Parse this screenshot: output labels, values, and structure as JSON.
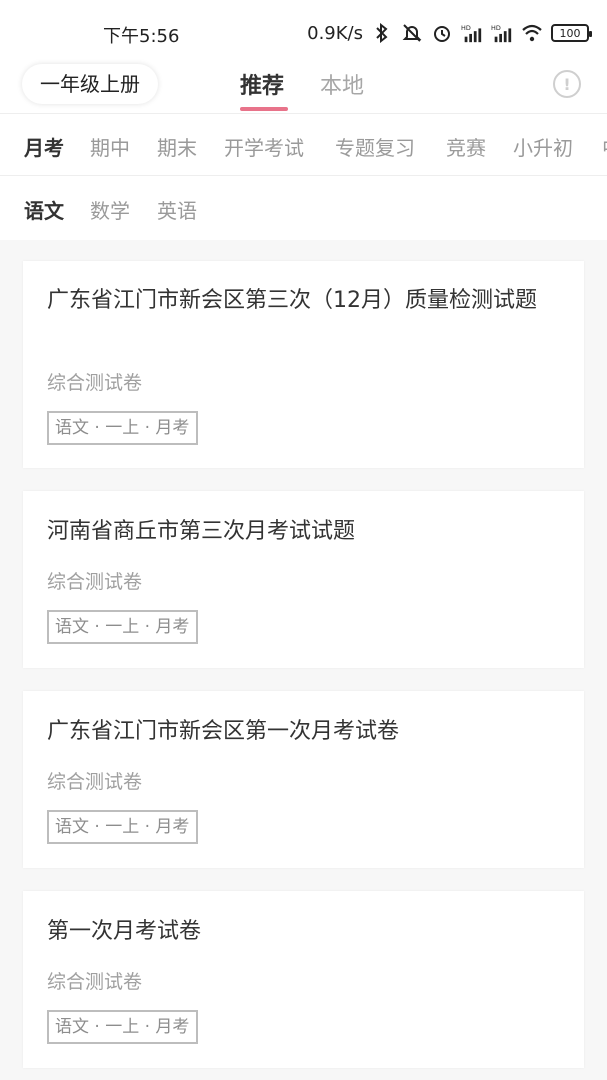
{
  "status_bar": {
    "time": "下午5:56",
    "network_speed": "0.9K/s",
    "icons": [
      "bluetooth-icon",
      "mute-bell-icon",
      "alarm-icon",
      "hd-signal-icon",
      "hd-signal-icon",
      "wifi-icon"
    ],
    "battery": "100"
  },
  "header": {
    "grade_selector": "一年级上册",
    "tabs": [
      {
        "label": "推荐",
        "active": true
      },
      {
        "label": "本地",
        "active": false
      }
    ],
    "info_icon": "!",
    "accent_color": "#e8738a"
  },
  "exam_types": [
    {
      "label": "月考",
      "active": true
    },
    {
      "label": "期中",
      "active": false
    },
    {
      "label": "期末",
      "active": false
    },
    {
      "label": "开学考试",
      "active": false
    },
    {
      "label": "专题复习",
      "active": false
    },
    {
      "label": "竞赛",
      "active": false
    },
    {
      "label": "小升初",
      "active": false
    },
    {
      "label": "中",
      "active": false
    }
  ],
  "subjects": [
    {
      "label": "语文",
      "active": true
    },
    {
      "label": "数学",
      "active": false
    },
    {
      "label": "英语",
      "active": false
    }
  ],
  "papers": [
    {
      "title": "广东省江门市新会区第三次（12月）质量检测试题",
      "type": "综合测试卷",
      "tag": "语文 · 一上 · 月考"
    },
    {
      "title": "河南省商丘市第三次月考试试题",
      "type": "综合测试卷",
      "tag": "语文 · 一上 · 月考"
    },
    {
      "title": "广东省江门市新会区第一次月考试卷",
      "type": "综合测试卷",
      "tag": "语文 · 一上 · 月考"
    },
    {
      "title": "第一次月考试卷",
      "type": "综合测试卷",
      "tag": "语文 · 一上 · 月考"
    }
  ]
}
